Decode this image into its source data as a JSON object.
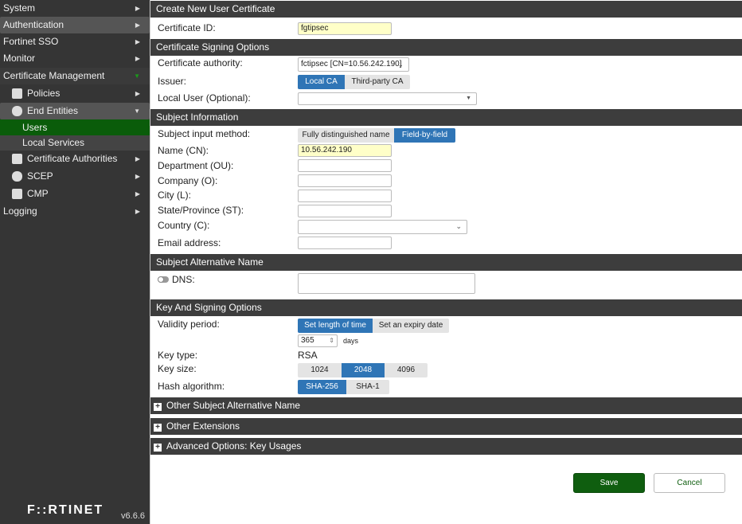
{
  "sidebar": {
    "items": [
      "System",
      "Authentication",
      "Fortinet SSO",
      "Monitor",
      "Certificate Management",
      "Policies",
      "End Entities",
      "Users",
      "Local Services",
      "Certificate Authorities",
      "SCEP",
      "CMP",
      "Logging"
    ],
    "logo": "F::RTINET",
    "version": "v6.6.6"
  },
  "form": {
    "title": "Create New User Certificate",
    "cert_id_label": "Certificate ID:",
    "cert_id_value": "fgtipsec",
    "signing_header": "Certificate Signing Options",
    "ca_label": "Certificate authority:",
    "ca_value": "fctipsec [CN=10.56.242.190]",
    "issuer_label": "Issuer:",
    "issuer_options": [
      "Local CA",
      "Third-party CA"
    ],
    "local_user_label": "Local User (Optional):",
    "local_user_value": "",
    "subject_header": "Subject Information",
    "input_method_label": "Subject input method:",
    "input_method_options": [
      "Fully distinguished name",
      "Field-by-field"
    ],
    "cn_label": "Name (CN):",
    "cn_value": "10.56.242.190",
    "ou_label": "Department (OU):",
    "o_label": "Company (O):",
    "l_label": "City (L):",
    "st_label": "State/Province (ST):",
    "c_label": "Country (C):",
    "email_label": "Email address:",
    "san_header": "Subject Alternative Name",
    "dns_label": "DNS:",
    "key_header": "Key And Signing Options",
    "validity_label": "Validity period:",
    "validity_options": [
      "Set length of time",
      "Set an expiry date"
    ],
    "validity_value": "365",
    "validity_unit": "days",
    "key_type_label": "Key type:",
    "key_type_value": "RSA",
    "key_size_label": "Key size:",
    "key_size_options": [
      "1024",
      "2048",
      "4096"
    ],
    "hash_label": "Hash algorithm:",
    "hash_options": [
      "SHA-256",
      "SHA-1"
    ],
    "collapsed": [
      "Other Subject Alternative Name",
      "Other Extensions",
      "Advanced Options: Key Usages"
    ],
    "save": "Save",
    "cancel": "Cancel"
  },
  "colors": {
    "accent": "#2f75b6",
    "save": "#0f5e0f",
    "active_nav": "#0a5c0a"
  }
}
